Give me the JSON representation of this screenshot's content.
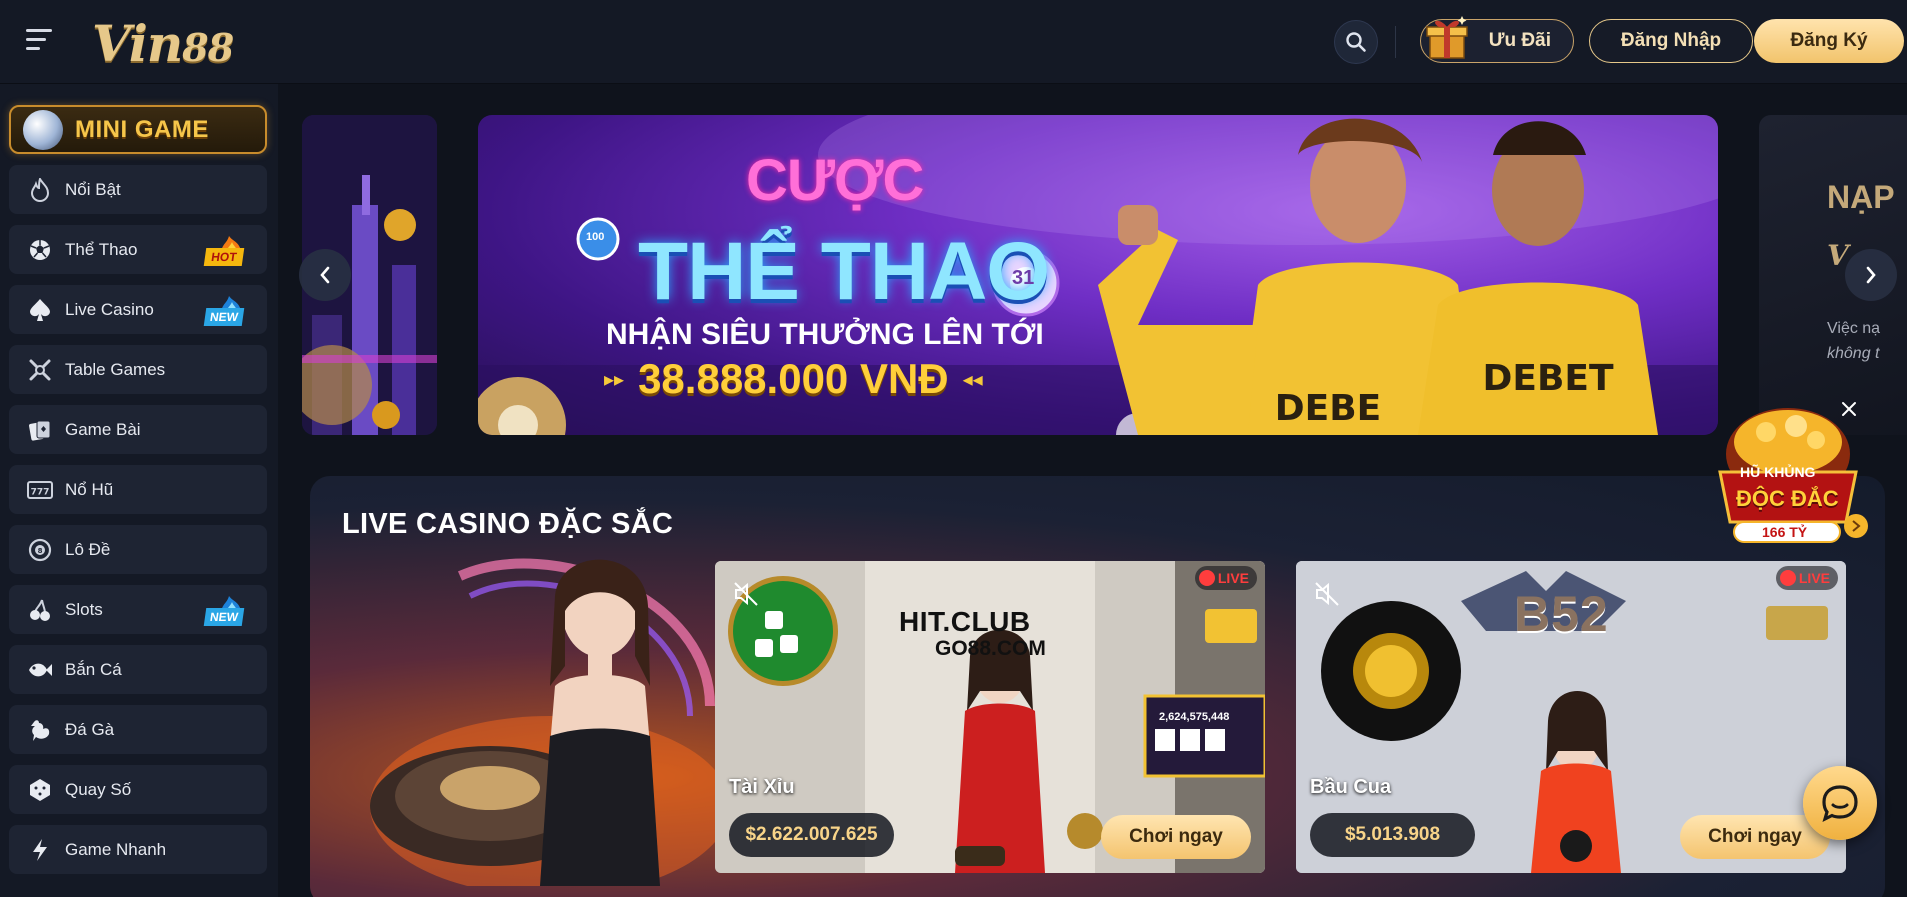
{
  "header": {
    "logo_main": "Vin",
    "logo_num": "88",
    "promo_label": "Ưu Đãi",
    "login_label": "Đăng Nhập",
    "signup_label": "Đăng Ký"
  },
  "sidebar": {
    "minigame_label": "MINI GAME",
    "items": [
      {
        "label": "Nổi Bật",
        "icon": "flame-icon"
      },
      {
        "label": "Thể Thao",
        "icon": "soccer-ball-icon",
        "badge": "HOT"
      },
      {
        "label": "Live Casino",
        "icon": "spade-icon",
        "badge": "NEW"
      },
      {
        "label": "Table Games",
        "icon": "crossed-clubs-icon"
      },
      {
        "label": "Game Bài",
        "icon": "playing-cards-icon"
      },
      {
        "label": "Nổ Hũ",
        "icon": "slot-777-icon"
      },
      {
        "label": "Lô Đề",
        "icon": "lottery-ball-icon"
      },
      {
        "label": "Slots",
        "icon": "cherries-icon",
        "badge": "NEW"
      },
      {
        "label": "Bắn Cá",
        "icon": "fish-icon"
      },
      {
        "label": "Đá Gà",
        "icon": "rooster-icon"
      },
      {
        "label": "Quay Số",
        "icon": "dice-icon"
      },
      {
        "label": "Game Nhanh",
        "icon": "lightning-icon"
      }
    ]
  },
  "banner": {
    "line1": "CƯỢC",
    "line2": "THỂ THAO",
    "line3": "NHẬN SIÊU THƯỞNG LÊN TỚI",
    "amount": "38.888.000 VNĐ",
    "ball_number": "31",
    "chip_label": "100",
    "right_peek_title": "NẠP",
    "right_peek_line1": "Việc nạ",
    "right_peek_line2": "không t"
  },
  "live_casino": {
    "title": "LIVE CASINO ĐẶC SẮC",
    "live_label": "LIVE",
    "play_label": "Chơi ngay",
    "games": [
      {
        "name": "Tài Xỉu",
        "jackpot": "$2.622.007.625",
        "brand": "HIT.CLUB",
        "brand_sub": "GO88.COM",
        "screen_value": "2,624,575,448"
      },
      {
        "name": "Bầu Cua",
        "jackpot": "$5.013.908",
        "brand": "B52",
        "screen_value": ""
      }
    ]
  },
  "float_jackpot": {
    "line1": "HŨ KHỦNG",
    "line2": "ĐỘC ĐẮC",
    "amount": "166 TỶ"
  },
  "colors": {
    "accent_gold": "#f2c46c",
    "sidebar_bg": "#141925",
    "nav_item_bg": "#1e2433",
    "live_red": "#ff3d3d"
  }
}
